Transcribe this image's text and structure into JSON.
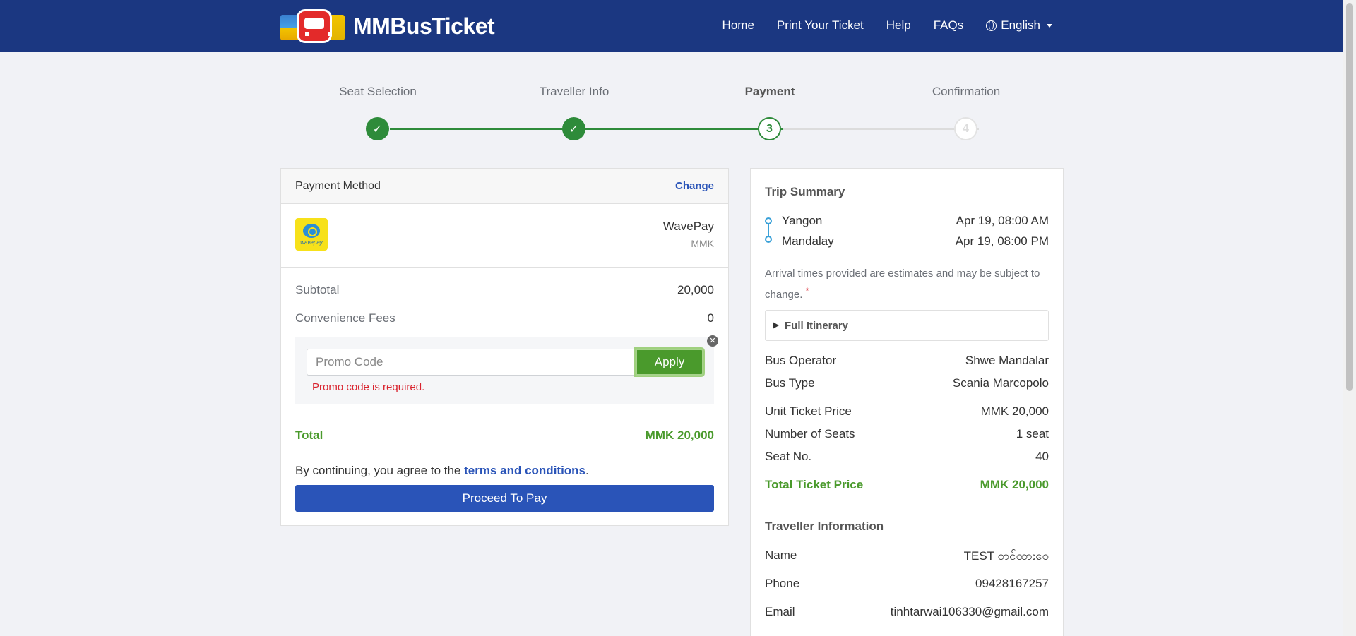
{
  "header": {
    "brand": "MMBusTicket",
    "nav": [
      {
        "label": "Home"
      },
      {
        "label": "Print Your Ticket"
      },
      {
        "label": "Help"
      },
      {
        "label": "FAQs"
      }
    ],
    "language": "English"
  },
  "steps": [
    {
      "label": "Seat Selection",
      "state": "done",
      "mark": "✓"
    },
    {
      "label": "Traveller Info",
      "state": "done",
      "mark": "✓"
    },
    {
      "label": "Payment",
      "state": "current",
      "mark": "3"
    },
    {
      "label": "Confirmation",
      "state": "todo",
      "mark": "4"
    }
  ],
  "payment": {
    "title": "Payment Method",
    "change_label": "Change",
    "method_logo_text": "wavepay",
    "method_name": "WavePay",
    "method_currency": "MMK",
    "subtotal_label": "Subtotal",
    "subtotal_value": "20,000",
    "fees_label": "Convenience Fees",
    "fees_value": "0",
    "promo_placeholder": "Promo Code",
    "promo_value": "",
    "apply_label": "Apply",
    "promo_error": "Promo code is required.",
    "total_label": "Total",
    "total_value": "MMK 20,000",
    "terms_prefix": "By continuing, you agree to the ",
    "terms_link": "terms and conditions",
    "terms_suffix": ".",
    "proceed_label": "Proceed To Pay"
  },
  "trip": {
    "title": "Trip Summary",
    "from_city": "Yangon",
    "from_time": "Apr 19, 08:00 AM",
    "to_city": "Mandalay",
    "to_time": "Apr 19, 08:00 PM",
    "note": "Arrival times provided are estimates and may be subject to change.",
    "note_mark": "*",
    "itinerary_label": "Full Itinerary",
    "details": [
      {
        "label": "Bus Operator",
        "value": "Shwe Mandalar"
      },
      {
        "label": "Bus Type",
        "value": "Scania Marcopolo"
      },
      {
        "label": "Unit Ticket Price",
        "value": "MMK 20,000"
      },
      {
        "label": "Number of Seats",
        "value": "1 seat"
      },
      {
        "label": "Seat No.",
        "value": "40"
      }
    ],
    "total_label": "Total Ticket Price",
    "total_value": "MMK 20,000",
    "traveller_title": "Traveller Information",
    "traveller": [
      {
        "label": "Name",
        "value": "TEST တင်ထားဝေ"
      },
      {
        "label": "Phone",
        "value": "09428167257"
      },
      {
        "label": "Email",
        "value": "tinhtarwai106330@gmail.com"
      }
    ]
  },
  "colors": {
    "header_bg": "#1b3781",
    "primary_blue": "#2a54b8",
    "success_green": "#2e8b3a",
    "total_green": "#4a9a2c",
    "error_red": "#d9232e"
  }
}
